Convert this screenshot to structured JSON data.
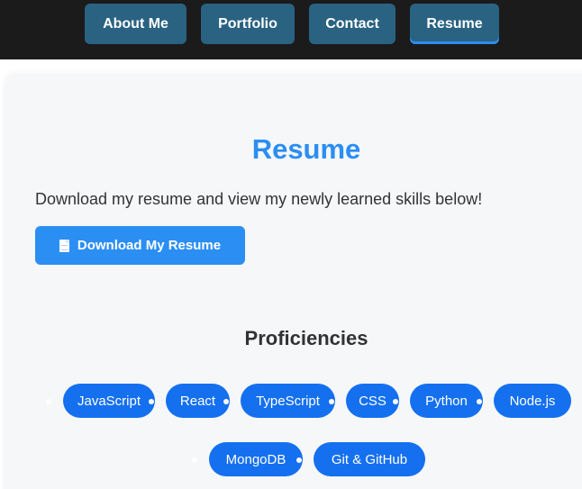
{
  "nav": {
    "about_label": "About Me",
    "portfolio_label": "Portfolio",
    "contact_label": "Contact",
    "resume_label": "Resume",
    "active": "Resume"
  },
  "resume": {
    "title": "Resume",
    "intro": "Download my resume and view my newly learned skills below!",
    "download_label": "Download My Resume",
    "download_icon": "document-icon"
  },
  "proficiencies": {
    "title": "Proficiencies",
    "skills": [
      "JavaScript",
      "React",
      "TypeScript",
      "CSS",
      "Python",
      "Node.js",
      "MongoDB",
      "Git & GitHub"
    ]
  },
  "colors": {
    "nav_bar": "#1b1b1b",
    "nav_button": "#2a6282",
    "accent": "#2b8ef2",
    "chip": "#1570ef",
    "card": "#f5f7f9"
  }
}
